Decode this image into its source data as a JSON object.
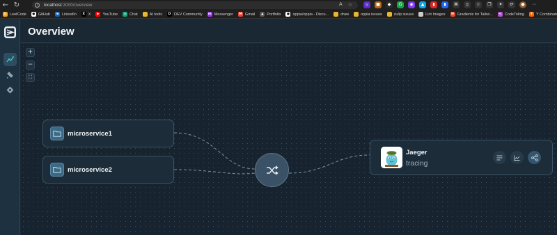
{
  "browser": {
    "url_host": "localhost",
    "url_path": ":3000/overview",
    "bookmarks": [
      {
        "label": "LeetCode",
        "icon": "leetcode-icon",
        "color": "#f5a623",
        "glyph": "L"
      },
      {
        "label": "GitHub",
        "icon": "github-icon",
        "color": "#ffffff",
        "glyph": "●"
      },
      {
        "label": "LinkedIn",
        "icon": "linkedin-icon",
        "color": "#0a66c2",
        "glyph": "in"
      },
      {
        "label": "X",
        "icon": "x-icon",
        "color": "#000000",
        "glyph": "X"
      },
      {
        "label": "YouTube",
        "icon": "youtube-icon",
        "color": "#ff0000",
        "glyph": "▶"
      },
      {
        "label": "Chat",
        "icon": "chat-icon",
        "color": "#10a37f",
        "glyph": "◎"
      },
      {
        "label": "AI tools",
        "icon": "folder-icon",
        "color": "#e8b730",
        "glyph": ""
      },
      {
        "label": "DEV Community",
        "icon": "dev-icon",
        "color": "#000000",
        "glyph": "D"
      },
      {
        "label": "Messenger",
        "icon": "messenger-icon",
        "color": "#a033ff",
        "glyph": "m"
      },
      {
        "label": "Gmail",
        "icon": "gmail-icon",
        "color": "#ea4335",
        "glyph": "M"
      },
      {
        "label": "Portfolio",
        "icon": "portfolio-icon",
        "color": "#555555",
        "glyph": "▲"
      },
      {
        "label": "oppia/oppia - Discu...",
        "icon": "github-icon",
        "color": "#ffffff",
        "glyph": "●"
      },
      {
        "label": "draw",
        "icon": "folder-icon",
        "color": "#e8b730",
        "glyph": ""
      },
      {
        "label": "oppia issues",
        "icon": "folder-icon",
        "color": "#e8b730",
        "glyph": ""
      },
      {
        "label": "zulip issues",
        "icon": "folder-icon",
        "color": "#e8b730",
        "glyph": ""
      },
      {
        "label": "Lint Images",
        "icon": "page-icon",
        "color": "#cccccc",
        "glyph": ""
      },
      {
        "label": "Gradients for Tailwi...",
        "icon": "gradients-icon",
        "color": "#e2492f",
        "glyph": "H"
      },
      {
        "label": "CodeToImg",
        "icon": "codetoimg-icon",
        "color": "#b84dd6",
        "glyph": "<"
      },
      {
        "label": "Y Combinator",
        "icon": "ycombinator-icon",
        "color": "#ff6600",
        "glyph": "Y"
      }
    ]
  },
  "header": {
    "title": "Overview"
  },
  "canvas": {
    "zoom_in": "+",
    "zoom_out": "−",
    "fit": "⛶"
  },
  "nodes": {
    "microservice1": {
      "label": "microservice1"
    },
    "microservice2": {
      "label": "microservice2"
    },
    "jaeger": {
      "name": "Jaeger",
      "type": "tracing"
    }
  },
  "colors": {
    "accent": "#3fd0c0",
    "hub": "#3b5166",
    "folder": "#3b6a86"
  }
}
